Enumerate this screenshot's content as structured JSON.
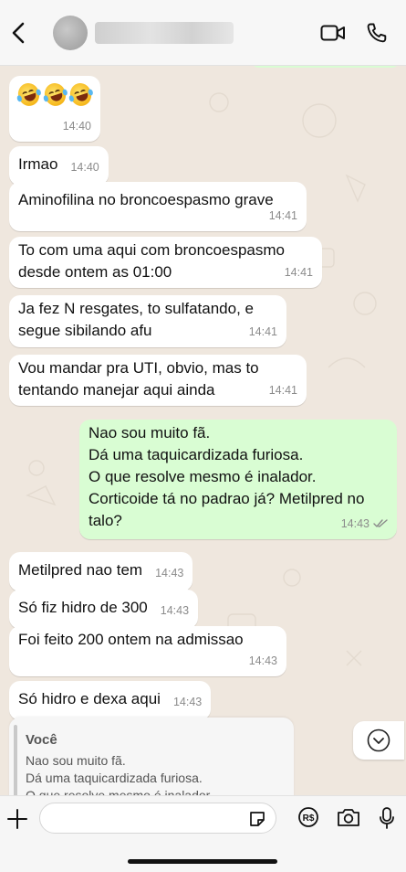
{
  "header": {
    "back_icon": "chevron-left-icon",
    "contact_name": "",
    "icons": [
      "video-call-icon",
      "phone-icon"
    ]
  },
  "messages": [
    {
      "dir": "in",
      "emoji": [
        "rolling-on-floor-laughing",
        "rolling-on-floor-laughing",
        "rolling-on-floor-laughing"
      ],
      "time": "14:40"
    },
    {
      "dir": "in",
      "text": "Irmao",
      "time": "14:40"
    },
    {
      "dir": "in",
      "text": "Aminofilina no broncoespasmo grave",
      "time": "14:41"
    },
    {
      "dir": "in",
      "lines": [
        "To com uma aqui com broncoespasmo",
        "desde ontem as 01:00"
      ],
      "time": "14:41"
    },
    {
      "dir": "in",
      "lines": [
        "Ja fez N resgates, to sulfatando, e",
        "segue sibilando afu"
      ],
      "time": "14:41"
    },
    {
      "dir": "in",
      "lines": [
        "Vou mandar pra UTI, obvio, mas to",
        "tentando manejar aqui ainda"
      ],
      "time": "14:41"
    },
    {
      "dir": "out",
      "lines": [
        "Nao sou muito fã.",
        "Dá uma taquicardizada furiosa.",
        "O que resolve mesmo é inalador.",
        "Corticoide tá no padrao já? Metilpred no",
        "talo?"
      ],
      "time": "14:43",
      "status": "read"
    },
    {
      "dir": "in",
      "text": "Metilpred nao tem",
      "time": "14:43"
    },
    {
      "dir": "in",
      "text": "Só fiz hidro de 300",
      "time": "14:43"
    },
    {
      "dir": "in",
      "text": "Foi feito 200 ontem na admissao",
      "time": "14:43"
    },
    {
      "dir": "in",
      "text": "Só hidro e dexa aqui",
      "time": "14:43"
    }
  ],
  "reply_preview": {
    "author": "Você",
    "lines": [
      "Nao sou muito fã.",
      "Dá uma taquicardizada furiosa.",
      "O que resolve mesmo é inalador."
    ]
  },
  "input_bar": {
    "placeholder": "",
    "icons": [
      "plus-icon",
      "sticker-icon",
      "payment-icon",
      "camera-icon",
      "microphone-icon"
    ]
  },
  "colors": {
    "incoming": "#ffffff",
    "outgoing": "#d9fdd3",
    "background": "#efe7de",
    "read_ticks": "#8b8b8b"
  }
}
